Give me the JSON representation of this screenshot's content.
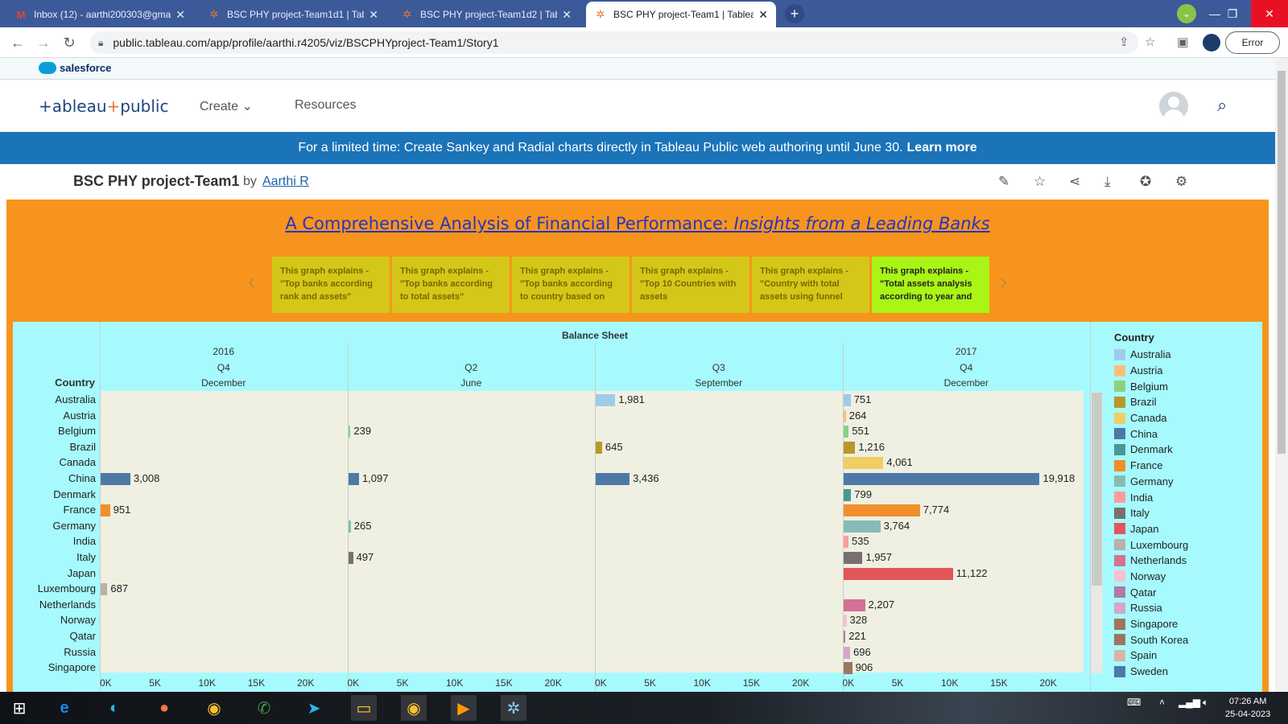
{
  "browser": {
    "tabs": [
      {
        "icon": "gmail-icon",
        "label": "Inbox (12) - aarthi200303@gmail",
        "active": false
      },
      {
        "icon": "tableau-icon",
        "label": "BSC PHY project-Team1d1 | Table",
        "active": false
      },
      {
        "icon": "tableau-icon",
        "label": "BSC PHY project-Team1d2 | Table",
        "active": false
      },
      {
        "icon": "tableau-icon",
        "label": "BSC PHY project-Team1 | Tableau",
        "active": true
      }
    ],
    "url": "public.tableau.com/app/profile/aarthi.r4205/viz/BSCPHYproject-Team1/Story1",
    "error_label": "Error"
  },
  "salesforce": {
    "label": "salesforce"
  },
  "header": {
    "logo": "+ableau+public",
    "logo_parts": {
      "a": "+ableau",
      "b": "+",
      "c": "public"
    },
    "nav": [
      {
        "label": "Create"
      },
      {
        "label": "Resources"
      }
    ]
  },
  "banner": {
    "text": "For a limited time: Create Sankey and Radial charts directly in Tableau Public web authoring until June 30.",
    "link": "Learn more"
  },
  "viz_header": {
    "title": "BSC PHY project-Team1",
    "by": "by",
    "author": "Aarthi R"
  },
  "story": {
    "title_main": "A Comprehensive Analysis of Financial Performance: ",
    "title_italic": "Insights from a Leading Banks",
    "points": [
      {
        "text": "This graph explains - \"Top banks according rank and assets\"",
        "active": false
      },
      {
        "text": "This graph explains - \"Top banks according to total assets\"",
        "active": false
      },
      {
        "text": "This graph explains - \"Top banks according to country based on",
        "active": false
      },
      {
        "text": "This graph explains - \"Top 10 Countries with assets",
        "active": false
      },
      {
        "text": "This graph explains - \"Country with total assets using funnel",
        "active": false
      },
      {
        "text": "This graph explains - \"Total assets analysis according to year and",
        "active": true
      }
    ]
  },
  "chart_data": {
    "type": "bar",
    "title": "Balance Sheet",
    "row_header": "Country",
    "columns": [
      {
        "year": "2016",
        "quarter": "Q4",
        "month": "December"
      },
      {
        "year": "",
        "quarter": "Q2",
        "month": "June"
      },
      {
        "year": "2017",
        "quarter": "Q3",
        "month": "September"
      },
      {
        "year": "",
        "quarter": "Q4",
        "month": "December"
      }
    ],
    "categories": [
      "Australia",
      "Austria",
      "Belgium",
      "Brazil",
      "Canada",
      "China",
      "Denmark",
      "France",
      "Germany",
      "India",
      "Italy",
      "Japan",
      "Luxembourg",
      "Netherlands",
      "Norway",
      "Qatar",
      "Russia",
      "Singapore"
    ],
    "series": [
      {
        "values": [
          null,
          null,
          null,
          null,
          null,
          3008,
          null,
          951,
          null,
          null,
          null,
          null,
          687,
          null,
          null,
          null,
          null,
          null
        ]
      },
      {
        "values": [
          null,
          null,
          239,
          null,
          null,
          1097,
          null,
          null,
          265,
          null,
          497,
          null,
          null,
          null,
          null,
          null,
          null,
          null
        ]
      },
      {
        "values": [
          1981,
          null,
          null,
          645,
          null,
          3436,
          null,
          null,
          null,
          null,
          null,
          null,
          null,
          null,
          null,
          null,
          null,
          null
        ]
      },
      {
        "values": [
          751,
          264,
          551,
          1216,
          4061,
          19918,
          799,
          7774,
          3764,
          535,
          1957,
          11122,
          null,
          2207,
          328,
          221,
          696,
          906
        ]
      }
    ],
    "value_labels": [
      [
        "",
        "",
        "",
        "",
        "",
        "3,008",
        "",
        "951",
        "",
        "",
        "",
        "",
        "687",
        "",
        "",
        "",
        "",
        ""
      ],
      [
        "",
        "",
        "239",
        "",
        "",
        "1,097",
        "",
        "",
        "265",
        "",
        "497",
        "",
        "",
        "",
        "",
        "",
        "",
        ""
      ],
      [
        "1,981",
        "",
        "",
        "645",
        "",
        "3,436",
        "",
        "",
        "",
        "",
        "",
        "",
        "",
        "",
        "",
        "",
        "",
        ""
      ],
      [
        "751",
        "264",
        "551",
        "1,216",
        "4,061",
        "19,918",
        "799",
        "7,774",
        "3,764",
        "535",
        "1,957",
        "11,122",
        "",
        "2,207",
        "328",
        "221",
        "696",
        "906"
      ]
    ],
    "xlim": [
      0,
      20000
    ],
    "x_ticks": [
      "0K",
      "5K",
      "10K",
      "15K",
      "20K"
    ],
    "legend": {
      "title": "Country",
      "position": "right",
      "items": [
        {
          "name": "Australia",
          "color": "#a0cbe8"
        },
        {
          "name": "Austria",
          "color": "#ffbe7d"
        },
        {
          "name": "Belgium",
          "color": "#8cd17d"
        },
        {
          "name": "Brazil",
          "color": "#b6992d"
        },
        {
          "name": "Canada",
          "color": "#f1ce63"
        },
        {
          "name": "China",
          "color": "#4e79a7"
        },
        {
          "name": "Denmark",
          "color": "#499894"
        },
        {
          "name": "France",
          "color": "#f28e2b"
        },
        {
          "name": "Germany",
          "color": "#86bcb6"
        },
        {
          "name": "India",
          "color": "#ff9d9a"
        },
        {
          "name": "Italy",
          "color": "#79706e"
        },
        {
          "name": "Japan",
          "color": "#e15759"
        },
        {
          "name": "Luxembourg",
          "color": "#bab0ac"
        },
        {
          "name": "Netherlands",
          "color": "#d37295"
        },
        {
          "name": "Norway",
          "color": "#fabfd2"
        },
        {
          "name": "Qatar",
          "color": "#b07aa1"
        },
        {
          "name": "Russia",
          "color": "#d4a6c8"
        },
        {
          "name": "Singapore",
          "color": "#9d7660"
        },
        {
          "name": "South Korea",
          "color": "#9d7660"
        },
        {
          "name": "Spain",
          "color": "#d7b5a6"
        },
        {
          "name": "Sweden",
          "color": "#4e79a7"
        }
      ]
    }
  },
  "taskbar": {
    "time": "07:26 AM",
    "date": "25-04-2023"
  }
}
